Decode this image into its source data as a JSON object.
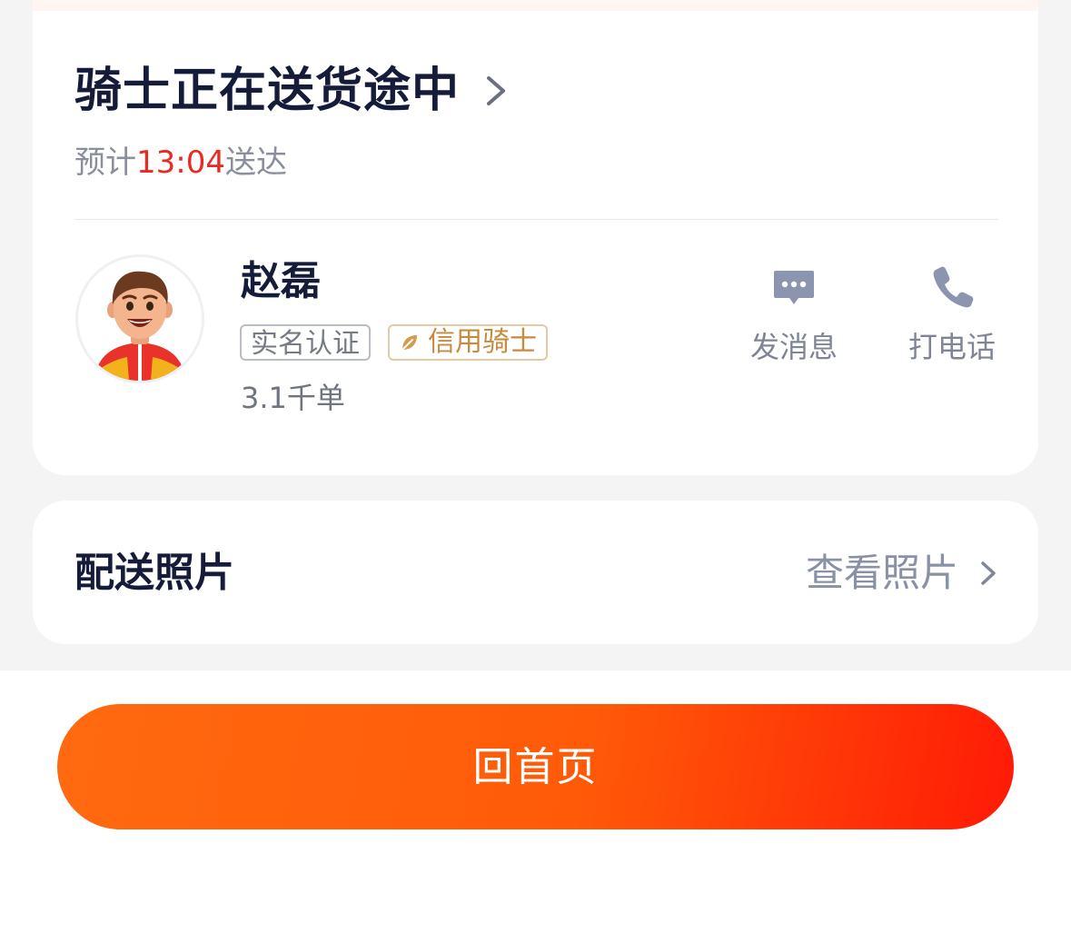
{
  "status": {
    "title": "骑士正在送货途中",
    "eta_prefix": "预计",
    "eta_time": "13:04",
    "eta_suffix": "送达"
  },
  "rider": {
    "name": "赵磊",
    "badges": {
      "verified": "实名认证",
      "credit": "信用骑士"
    },
    "orders": "3.1千单",
    "actions": {
      "message": "发消息",
      "call": "打电话"
    }
  },
  "photos": {
    "title": "配送照片",
    "link_label": "查看照片"
  },
  "footer": {
    "home_button": "回首页"
  },
  "colors": {
    "eta_highlight": "#e82a20",
    "credit_badge": "#c88a3e",
    "button_gradient_start": "#ff6a10",
    "button_gradient_end": "#ff1a06"
  },
  "icons": {
    "status_arrow": "chevron-right-icon",
    "message": "chat-bubble-icon",
    "call": "phone-icon",
    "credit": "leaf-icon",
    "photo_arrow": "chevron-right-icon"
  }
}
